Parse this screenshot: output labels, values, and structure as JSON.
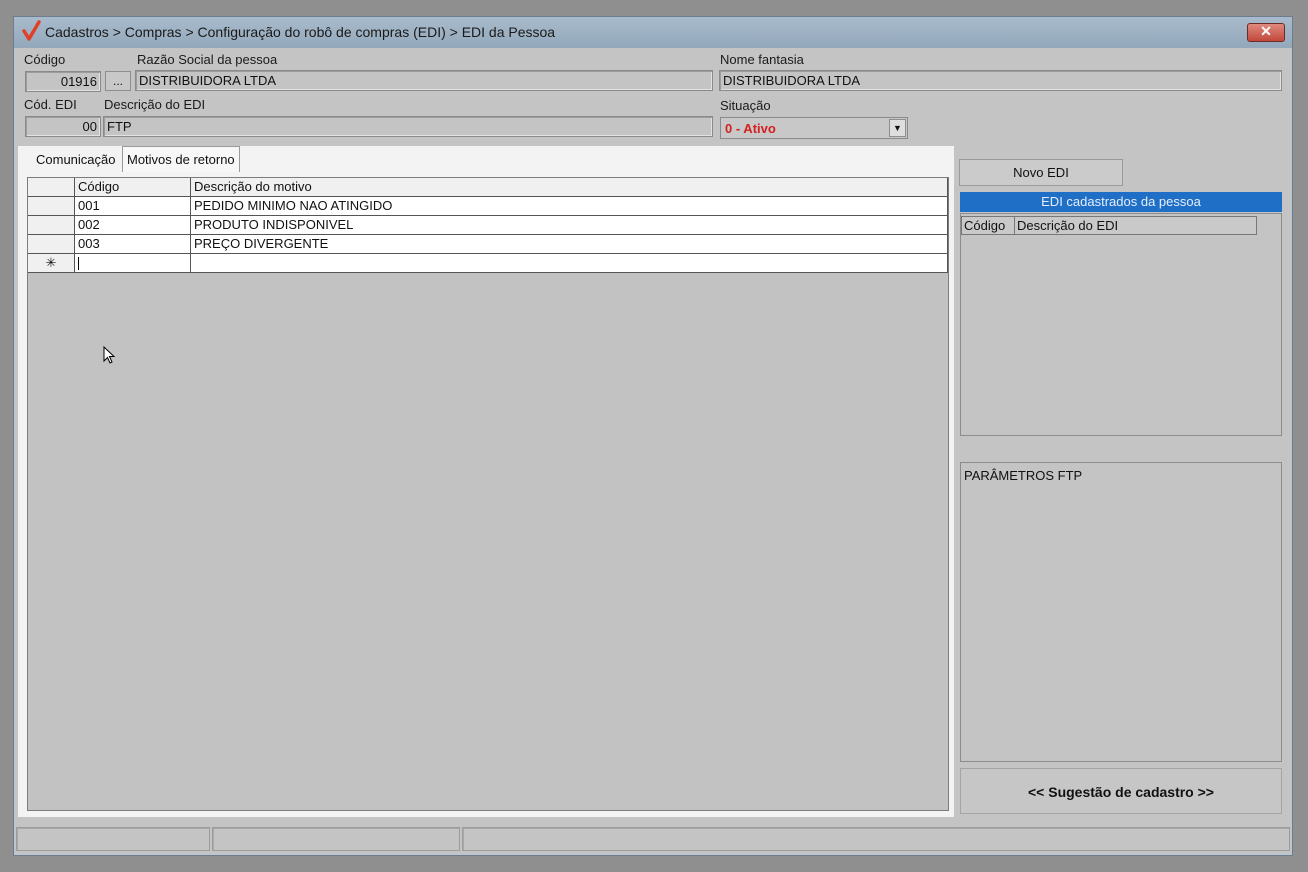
{
  "window": {
    "title": "Cadastros > Compras > Configuração do robô de compras (EDI) > EDI da Pessoa",
    "close_symbol": "✕"
  },
  "form": {
    "codigo_label": "Código",
    "codigo_value": "01916",
    "dots_label": "...",
    "razao_label": "Razão Social da pessoa",
    "razao_value": "DISTRIBUIDORA LTDA",
    "fantasia_label": "Nome fantasia",
    "fantasia_value": "DISTRIBUIDORA LTDA",
    "cod_edi_label": "Cód. EDI",
    "cod_edi_value": "00",
    "desc_edi_label": "Descrição do EDI",
    "desc_edi_value": "FTP",
    "situacao_label": "Situação",
    "situacao_value": "0 - Ativo",
    "accent_color": "#d42020"
  },
  "tabs": [
    {
      "label": "Comunicação",
      "active": false
    },
    {
      "label": "Motivos de retorno",
      "active": true
    }
  ],
  "grid": {
    "columns": [
      "Código",
      "Descrição do motivo"
    ],
    "rows": [
      {
        "codigo": "001",
        "descricao": "PEDIDO MINIMO NAO ATINGIDO"
      },
      {
        "codigo": "002",
        "descricao": "PRODUTO INDISPONIVEL"
      },
      {
        "codigo": "003",
        "descricao": "PREÇO DIVERGENTE"
      }
    ],
    "new_row_marker": "✳"
  },
  "sidebar": {
    "novo_edi_label": "Novo EDI",
    "edi_list_title": "EDI cadastrados da pessoa",
    "edi_list_columns": [
      "Código",
      "Descrição do EDI"
    ],
    "params_text": "PARÂMETROS FTP",
    "sugestao_label": "<< Sugestão de cadastro >>",
    "header_color": "#1f6fc6"
  }
}
